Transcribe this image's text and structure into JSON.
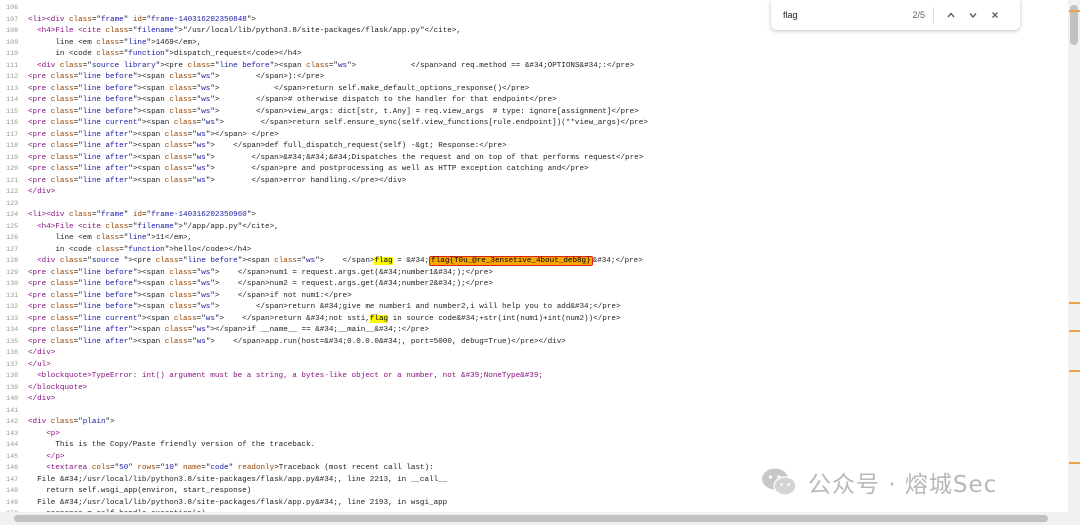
{
  "find_bar": {
    "query": "flag",
    "count": "2/5"
  },
  "watermark": {
    "text": "公众号 · 熔城Sec"
  },
  "colors": {
    "tag": "#881280",
    "attr": "#994500",
    "value": "#1a1aa6",
    "highlight": "#fdfa00",
    "active_highlight": "#f7a600",
    "box": "#e2231a"
  },
  "lines": [
    {
      "n": "106",
      "parts": []
    },
    {
      "n": "107",
      "parts": [
        [
          "t",
          "<li><div "
        ],
        [
          "a",
          "class"
        ],
        [
          "t",
          "=\""
        ],
        [
          "v",
          "frame"
        ],
        [
          "t",
          "\" "
        ],
        [
          "a",
          "id"
        ],
        [
          "t",
          "=\""
        ],
        [
          "v",
          "frame-140316202350848"
        ],
        [
          "t",
          "\">"
        ]
      ]
    },
    {
      "n": "108",
      "parts": [
        [
          "t",
          "  <h4>File <cite "
        ],
        [
          "a",
          "class"
        ],
        [
          "t",
          "=\""
        ],
        [
          "v",
          "filename"
        ],
        [
          "t",
          "\">\"/usr/local/lib/python3.8/site-packages/flask/app.py\"</cite>,"
        ]
      ]
    },
    {
      "n": "109",
      "parts": [
        [
          "t",
          "      line <em "
        ],
        [
          "a",
          "class"
        ],
        [
          "t",
          "=\""
        ],
        [
          "v",
          "line"
        ],
        [
          "t",
          "\">1469</em>,"
        ]
      ]
    },
    {
      "n": "110",
      "parts": [
        [
          "t",
          "      in <code "
        ],
        [
          "a",
          "class"
        ],
        [
          "t",
          "=\""
        ],
        [
          "v",
          "function"
        ],
        [
          "t",
          "\">dispatch_request</code></h4>"
        ]
      ]
    },
    {
      "n": "111",
      "parts": [
        [
          "t",
          "  <div "
        ],
        [
          "a",
          "class"
        ],
        [
          "t",
          "=\""
        ],
        [
          "v",
          "source library"
        ],
        [
          "t",
          "\"><pre "
        ],
        [
          "a",
          "class"
        ],
        [
          "t",
          "=\""
        ],
        [
          "v",
          "line before"
        ],
        [
          "t",
          "\"><span "
        ],
        [
          "a",
          "class"
        ],
        [
          "t",
          "=\""
        ],
        [
          "v",
          "ws"
        ],
        [
          "t",
          "\">            </span>and req.method == &#34;OPTIONS&#34;:</pre>"
        ]
      ]
    },
    {
      "n": "112",
      "parts": [
        [
          "t",
          "<pre "
        ],
        [
          "a",
          "class"
        ],
        [
          "t",
          "=\""
        ],
        [
          "v",
          "line before"
        ],
        [
          "t",
          "\"><span "
        ],
        [
          "a",
          "class"
        ],
        [
          "t",
          "=\""
        ],
        [
          "v",
          "ws"
        ],
        [
          "t",
          "\">        </span>):</pre>"
        ]
      ]
    },
    {
      "n": "113",
      "parts": [
        [
          "t",
          "<pre "
        ],
        [
          "a",
          "class"
        ],
        [
          "t",
          "=\""
        ],
        [
          "v",
          "line before"
        ],
        [
          "t",
          "\"><span "
        ],
        [
          "a",
          "class"
        ],
        [
          "t",
          "=\""
        ],
        [
          "v",
          "ws"
        ],
        [
          "t",
          "\">            </span>return self.make_default_options_response()</pre>"
        ]
      ]
    },
    {
      "n": "114",
      "parts": [
        [
          "t",
          "<pre "
        ],
        [
          "a",
          "class"
        ],
        [
          "t",
          "=\""
        ],
        [
          "v",
          "line before"
        ],
        [
          "t",
          "\"><span "
        ],
        [
          "a",
          "class"
        ],
        [
          "t",
          "=\""
        ],
        [
          "v",
          "ws"
        ],
        [
          "t",
          "\">        </span># otherwise dispatch to the handler for that endpoint</pre>"
        ]
      ]
    },
    {
      "n": "115",
      "parts": [
        [
          "t",
          "<pre "
        ],
        [
          "a",
          "class"
        ],
        [
          "t",
          "=\""
        ],
        [
          "v",
          "line before"
        ],
        [
          "t",
          "\"><span "
        ],
        [
          "a",
          "class"
        ],
        [
          "t",
          "=\""
        ],
        [
          "v",
          "ws"
        ],
        [
          "t",
          "\">        </span>view_args: dict[str, t.Any] = req.view_args  # type: ignore[assignment]</pre>"
        ]
      ]
    },
    {
      "n": "116",
      "parts": [
        [
          "t",
          "<pre "
        ],
        [
          "a",
          "class"
        ],
        [
          "t",
          "=\""
        ],
        [
          "v",
          "line current"
        ],
        [
          "t",
          "\"><span "
        ],
        [
          "a",
          "class"
        ],
        [
          "t",
          "=\""
        ],
        [
          "v",
          "ws"
        ],
        [
          "t",
          "\">        </span>return self.ensure_sync(self.view_functions[rule.endpoint])(**view_args)</pre>"
        ]
      ]
    },
    {
      "n": "117",
      "parts": [
        [
          "t",
          "<pre "
        ],
        [
          "a",
          "class"
        ],
        [
          "t",
          "=\""
        ],
        [
          "v",
          "line after"
        ],
        [
          "t",
          "\"><span "
        ],
        [
          "a",
          "class"
        ],
        [
          "t",
          "=\""
        ],
        [
          "v",
          "ws"
        ],
        [
          "t",
          "\"></span> </pre>"
        ]
      ]
    },
    {
      "n": "118",
      "parts": [
        [
          "t",
          "<pre "
        ],
        [
          "a",
          "class"
        ],
        [
          "t",
          "=\""
        ],
        [
          "v",
          "line after"
        ],
        [
          "t",
          "\"><span "
        ],
        [
          "a",
          "class"
        ],
        [
          "t",
          "=\""
        ],
        [
          "v",
          "ws"
        ],
        [
          "t",
          "\">    </span>def full_dispatch_request(self) -&gt; Response:</pre>"
        ]
      ]
    },
    {
      "n": "119",
      "parts": [
        [
          "t",
          "<pre "
        ],
        [
          "a",
          "class"
        ],
        [
          "t",
          "=\""
        ],
        [
          "v",
          "line after"
        ],
        [
          "t",
          "\"><span "
        ],
        [
          "a",
          "class"
        ],
        [
          "t",
          "=\""
        ],
        [
          "v",
          "ws"
        ],
        [
          "t",
          "\">        </span>&#34;&#34;&#34;Dispatches the request and on top of that performs request</pre>"
        ]
      ]
    },
    {
      "n": "120",
      "parts": [
        [
          "t",
          "<pre "
        ],
        [
          "a",
          "class"
        ],
        [
          "t",
          "=\""
        ],
        [
          "v",
          "line after"
        ],
        [
          "t",
          "\"><span "
        ],
        [
          "a",
          "class"
        ],
        [
          "t",
          "=\""
        ],
        [
          "v",
          "ws"
        ],
        [
          "t",
          "\">        </span>pre and postprocessing as well as HTTP exception catching and</pre>"
        ]
      ]
    },
    {
      "n": "121",
      "parts": [
        [
          "t",
          "<pre "
        ],
        [
          "a",
          "class"
        ],
        [
          "t",
          "=\""
        ],
        [
          "v",
          "line after"
        ],
        [
          "t",
          "\"><span "
        ],
        [
          "a",
          "class"
        ],
        [
          "t",
          "=\""
        ],
        [
          "v",
          "ws"
        ],
        [
          "t",
          "\">        </span>error handling.</pre></div>"
        ]
      ]
    },
    {
      "n": "122",
      "parts": [
        [
          "t",
          "</div>"
        ]
      ]
    },
    {
      "n": "123",
      "parts": []
    },
    {
      "n": "124",
      "parts": [
        [
          "t",
          "<li><div "
        ],
        [
          "a",
          "class"
        ],
        [
          "t",
          "=\""
        ],
        [
          "v",
          "frame"
        ],
        [
          "t",
          "\" "
        ],
        [
          "a",
          "id"
        ],
        [
          "t",
          "=\""
        ],
        [
          "v",
          "frame-140316202350960"
        ],
        [
          "t",
          "\">"
        ]
      ]
    },
    {
      "n": "125",
      "parts": [
        [
          "t",
          "  <h4>File <cite "
        ],
        [
          "a",
          "class"
        ],
        [
          "t",
          "=\""
        ],
        [
          "v",
          "filename"
        ],
        [
          "t",
          "\">\"/app/app.py\"</cite>,"
        ]
      ]
    },
    {
      "n": "126",
      "parts": [
        [
          "t",
          "      line <em "
        ],
        [
          "a",
          "class"
        ],
        [
          "t",
          "=\""
        ],
        [
          "v",
          "line"
        ],
        [
          "t",
          "\">11</em>,"
        ]
      ]
    },
    {
      "n": "127",
      "parts": [
        [
          "t",
          "      in <code "
        ],
        [
          "a",
          "class"
        ],
        [
          "t",
          "=\""
        ],
        [
          "v",
          "function"
        ],
        [
          "t",
          "\">hello</code></h4>"
        ]
      ]
    },
    {
      "n": "128",
      "parts": [
        [
          "t",
          "  <div "
        ],
        [
          "a",
          "class"
        ],
        [
          "t",
          "=\""
        ],
        [
          "v",
          "source "
        ],
        [
          "t",
          "\"><pre "
        ],
        [
          "a",
          "class"
        ],
        [
          "t",
          "=\""
        ],
        [
          "v",
          "line before"
        ],
        [
          "t",
          "\"><span "
        ],
        [
          "a",
          "class"
        ],
        [
          "t",
          "=\""
        ],
        [
          "v",
          "ws"
        ],
        [
          "t",
          "\">    </span>"
        ],
        [
          "h",
          "flag"
        ],
        [
          "t",
          " = &#34;"
        ],
        [
          "box",
          "flag{T0u_@re_3ensetive_4bout_deb8g}"
        ],
        [
          "t",
          "&#34;</pre>"
        ]
      ]
    },
    {
      "n": "129",
      "parts": [
        [
          "t",
          "<pre "
        ],
        [
          "a",
          "class"
        ],
        [
          "t",
          "=\""
        ],
        [
          "v",
          "line before"
        ],
        [
          "t",
          "\"><span "
        ],
        [
          "a",
          "class"
        ],
        [
          "t",
          "=\""
        ],
        [
          "v",
          "ws"
        ],
        [
          "t",
          "\">    </span>num1 = request.args.get(&#34;number1&#34;);</pre>"
        ]
      ]
    },
    {
      "n": "130",
      "parts": [
        [
          "t",
          "<pre "
        ],
        [
          "a",
          "class"
        ],
        [
          "t",
          "=\""
        ],
        [
          "v",
          "line before"
        ],
        [
          "t",
          "\"><span "
        ],
        [
          "a",
          "class"
        ],
        [
          "t",
          "=\""
        ],
        [
          "v",
          "ws"
        ],
        [
          "t",
          "\">    </span>num2 = request.args.get(&#34;number2&#34;);</pre>"
        ]
      ]
    },
    {
      "n": "131",
      "parts": [
        [
          "t",
          "<pre "
        ],
        [
          "a",
          "class"
        ],
        [
          "t",
          "=\""
        ],
        [
          "v",
          "line before"
        ],
        [
          "t",
          "\"><span "
        ],
        [
          "a",
          "class"
        ],
        [
          "t",
          "=\""
        ],
        [
          "v",
          "ws"
        ],
        [
          "t",
          "\">    </span>if not num1:</pre>"
        ]
      ]
    },
    {
      "n": "132",
      "parts": [
        [
          "t",
          "<pre "
        ],
        [
          "a",
          "class"
        ],
        [
          "t",
          "=\""
        ],
        [
          "v",
          "line before"
        ],
        [
          "t",
          "\"><span "
        ],
        [
          "a",
          "class"
        ],
        [
          "t",
          "=\""
        ],
        [
          "v",
          "ws"
        ],
        [
          "t",
          "\">        </span>return &#34;give me number1 and number2,i will help you to add&#34;</pre>"
        ]
      ]
    },
    {
      "n": "133",
      "parts": [
        [
          "t",
          "<pre "
        ],
        [
          "a",
          "class"
        ],
        [
          "t",
          "=\""
        ],
        [
          "v",
          "line current"
        ],
        [
          "t",
          "\"><span "
        ],
        [
          "a",
          "class"
        ],
        [
          "t",
          "=\""
        ],
        [
          "v",
          "ws"
        ],
        [
          "t",
          "\">    </span>return &#34;not ssti,"
        ],
        [
          "h",
          "flag"
        ],
        [
          "t",
          " in source code&#34;+str(int(num1)+int(num2))</pre>"
        ]
      ]
    },
    {
      "n": "134",
      "parts": [
        [
          "t",
          "<pre "
        ],
        [
          "a",
          "class"
        ],
        [
          "t",
          "=\""
        ],
        [
          "v",
          "line after"
        ],
        [
          "t",
          "\"><span "
        ],
        [
          "a",
          "class"
        ],
        [
          "t",
          "=\""
        ],
        [
          "v",
          "ws"
        ],
        [
          "t",
          "\"></span>if __name__ == &#34;__main__&#34;:</pre>"
        ]
      ]
    },
    {
      "n": "135",
      "parts": [
        [
          "t",
          "<pre "
        ],
        [
          "a",
          "class"
        ],
        [
          "t",
          "=\""
        ],
        [
          "v",
          "line after"
        ],
        [
          "t",
          "\"><span "
        ],
        [
          "a",
          "class"
        ],
        [
          "t",
          "=\""
        ],
        [
          "v",
          "ws"
        ],
        [
          "t",
          "\">    </span>app.run(host=&#34;0.0.0.0&#34;, port=5000, debug=True)</pre></div>"
        ]
      ]
    },
    {
      "n": "136",
      "parts": [
        [
          "t",
          "</div>"
        ]
      ]
    },
    {
      "n": "137",
      "parts": [
        [
          "t",
          "</ul>"
        ]
      ]
    },
    {
      "n": "138",
      "parts": [
        [
          "t",
          "  <blockquote>TypeError: int() argument must be a string, a bytes-like object or a number, not &#39;NoneType&#39;"
        ]
      ]
    },
    {
      "n": "139",
      "parts": [
        [
          "t",
          "</blockquote>"
        ]
      ]
    },
    {
      "n": "140",
      "parts": [
        [
          "t",
          "</div>"
        ]
      ]
    },
    {
      "n": "141",
      "parts": []
    },
    {
      "n": "142",
      "parts": [
        [
          "t",
          "<div "
        ],
        [
          "a",
          "class"
        ],
        [
          "t",
          "=\""
        ],
        [
          "v",
          "plain"
        ],
        [
          "t",
          "\">"
        ]
      ]
    },
    {
      "n": "143",
      "parts": [
        [
          "t",
          "    <p>"
        ]
      ]
    },
    {
      "n": "144",
      "parts": [
        [
          "t",
          "      This is the Copy/Paste friendly version of the traceback."
        ]
      ]
    },
    {
      "n": "145",
      "parts": [
        [
          "t",
          "    </p>"
        ]
      ]
    },
    {
      "n": "146",
      "parts": [
        [
          "t",
          "    <textarea "
        ],
        [
          "a",
          "cols"
        ],
        [
          "t",
          "=\""
        ],
        [
          "v",
          "50"
        ],
        [
          "t",
          "\" "
        ],
        [
          "a",
          "rows"
        ],
        [
          "t",
          "=\""
        ],
        [
          "v",
          "10"
        ],
        [
          "t",
          "\" "
        ],
        [
          "a",
          "name"
        ],
        [
          "t",
          "=\""
        ],
        [
          "v",
          "code"
        ],
        [
          "t",
          "\" "
        ],
        [
          "a",
          "readonly"
        ],
        [
          "t",
          ">Traceback (most recent call last):"
        ]
      ]
    },
    {
      "n": "147",
      "parts": [
        [
          "t",
          "  File &#34;/usr/local/lib/python3.8/site-packages/flask/app.py&#34;, line 2213, in __call__"
        ]
      ]
    },
    {
      "n": "148",
      "parts": [
        [
          "t",
          "    return self.wsgi_app(environ, start_response)"
        ]
      ]
    },
    {
      "n": "149",
      "parts": [
        [
          "t",
          "  File &#34;/usr/local/lib/python3.8/site-packages/flask/app.py&#34;, line 2193, in wsgi_app"
        ]
      ]
    },
    {
      "n": "150",
      "parts": [
        [
          "t",
          "    response = self.handle_exception(e)"
        ]
      ]
    }
  ]
}
